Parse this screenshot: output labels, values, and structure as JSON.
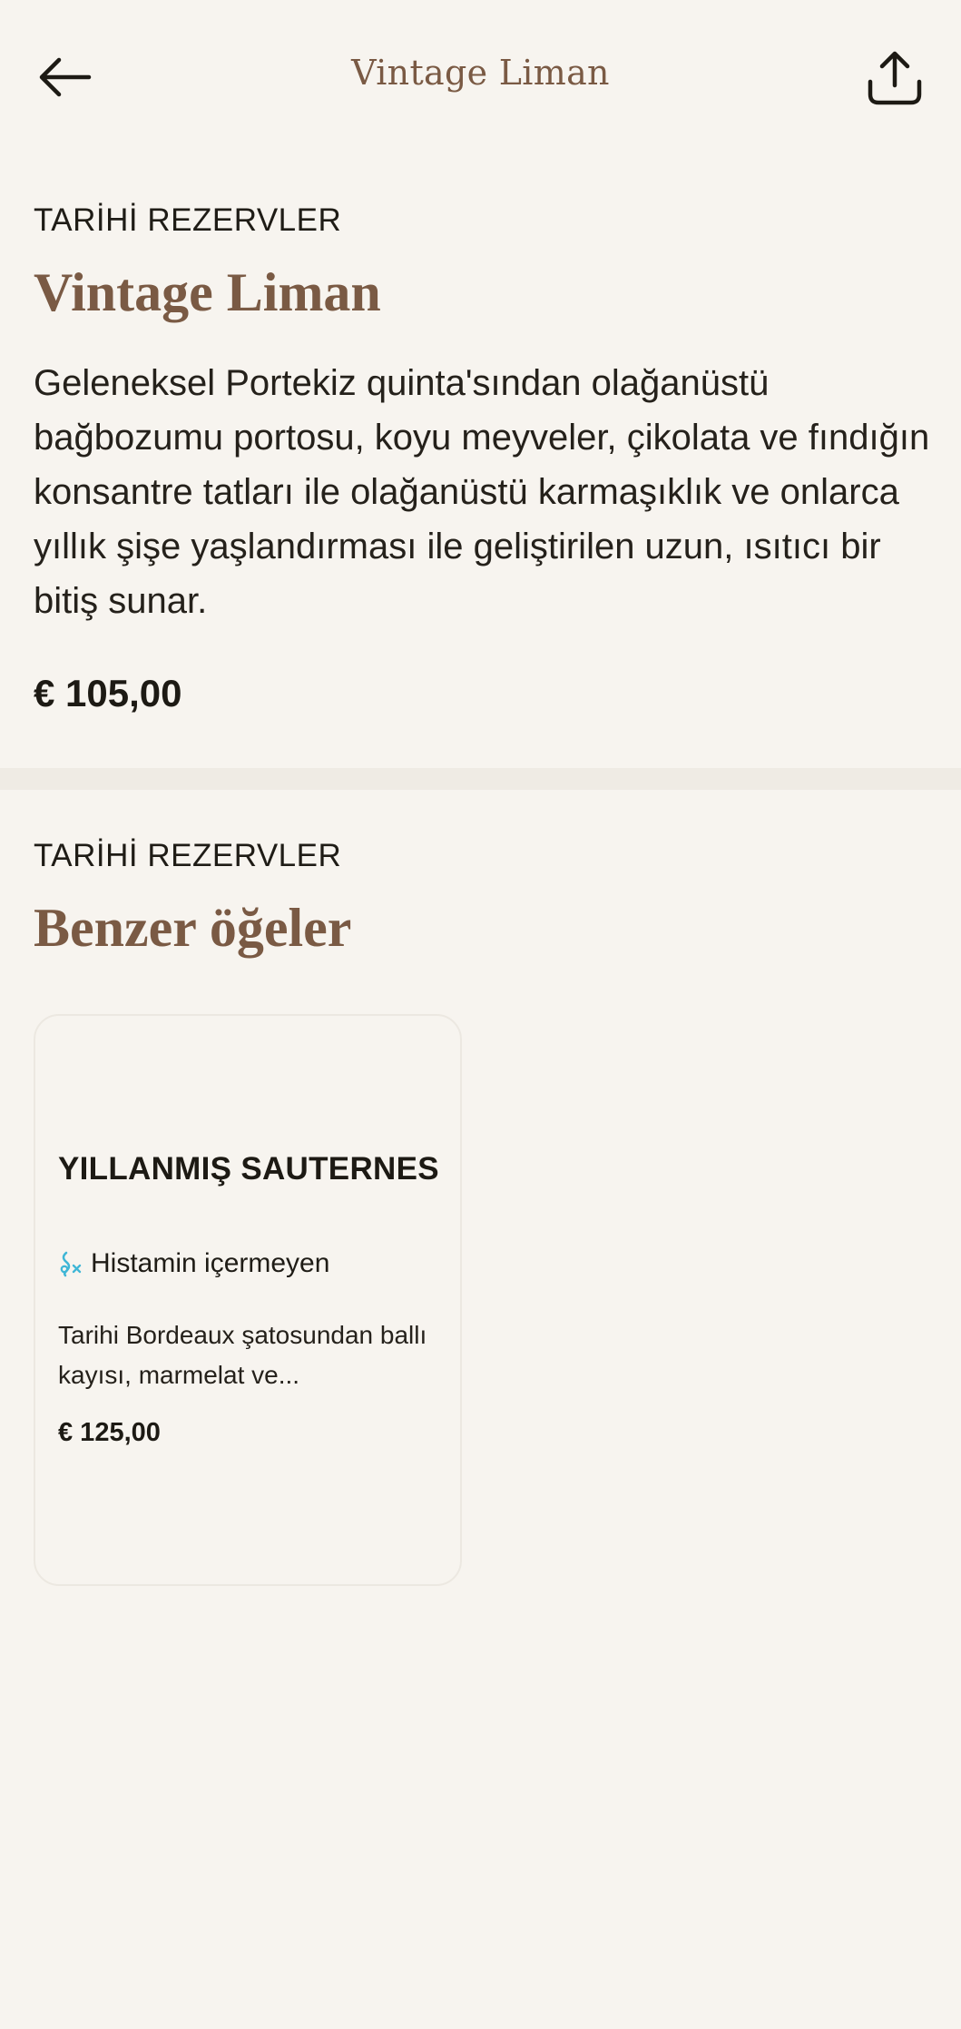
{
  "header": {
    "title": "Vintage Liman"
  },
  "product": {
    "category": "TARİHİ REZERVLER",
    "name": "Vintage Liman",
    "description": "Geleneksel Portekiz quinta'sından olağanüstü bağbozumu portosu, koyu meyveler, çikolata ve fındığın konsantre tatları ile olağanüstü karmaşıklık ve onlarca yıllık şişe yaşlandırması ile geliştirilen uzun, ısıtıcı bir bitiş sunar.",
    "price": "€ 105,00"
  },
  "similar": {
    "category": "TARİHİ REZERVLER",
    "heading": "Benzer öğeler",
    "items": [
      {
        "name": "YILLANMIŞ SAUTERNES",
        "tag": "Histamin içermeyen",
        "tag_icon": "histamine-free-icon",
        "description": "Tarihi Bordeaux şatosundan ballı kayısı, marmelat ve...",
        "price": "€ 125,00"
      }
    ]
  },
  "colors": {
    "background": "#f7f4ef",
    "accent": "#7a5a44",
    "text": "#1d1a14",
    "tag_icon": "#3fb6d6"
  }
}
